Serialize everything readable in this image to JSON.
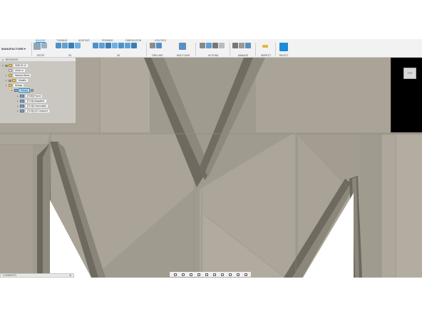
{
  "toolbar": {
    "workspace": "MANUFACTURE",
    "tabs": [
      "MILLING",
      "TURNING",
      "ADDITIVE",
      "PROBING",
      "FABRICATION",
      "UTILITIES"
    ],
    "active_tab": "MILLING",
    "groups": {
      "setup": "SETUP",
      "two_d": "2D",
      "three_d": "3D",
      "drilling": "DRILLING",
      "multi_axis": "MULTI-AXIS",
      "actions": "ACTIONS",
      "manage": "MANAGE",
      "inspect": "INSPECT",
      "select": "SELECT"
    }
  },
  "browser": {
    "title": "BROWSER",
    "root": "SMD-M v2",
    "units": "Units: in",
    "named_views": "Named Views",
    "models": "Models",
    "setups": "Setups",
    "setup1": "Setup1",
    "operations": [
      "[T330] Face2",
      "[T104] Adaptive1",
      "[T103] Horizontal2",
      "[T103] 2D Contour4"
    ]
  },
  "viewcube": {
    "label": "TOP"
  },
  "comments": {
    "label": "COMMENTS"
  },
  "colors": {
    "accent": "#1a8cd8",
    "stock": "#a09b8f",
    "face": "#b1ab9f",
    "shadow": "#6f6a5f"
  }
}
